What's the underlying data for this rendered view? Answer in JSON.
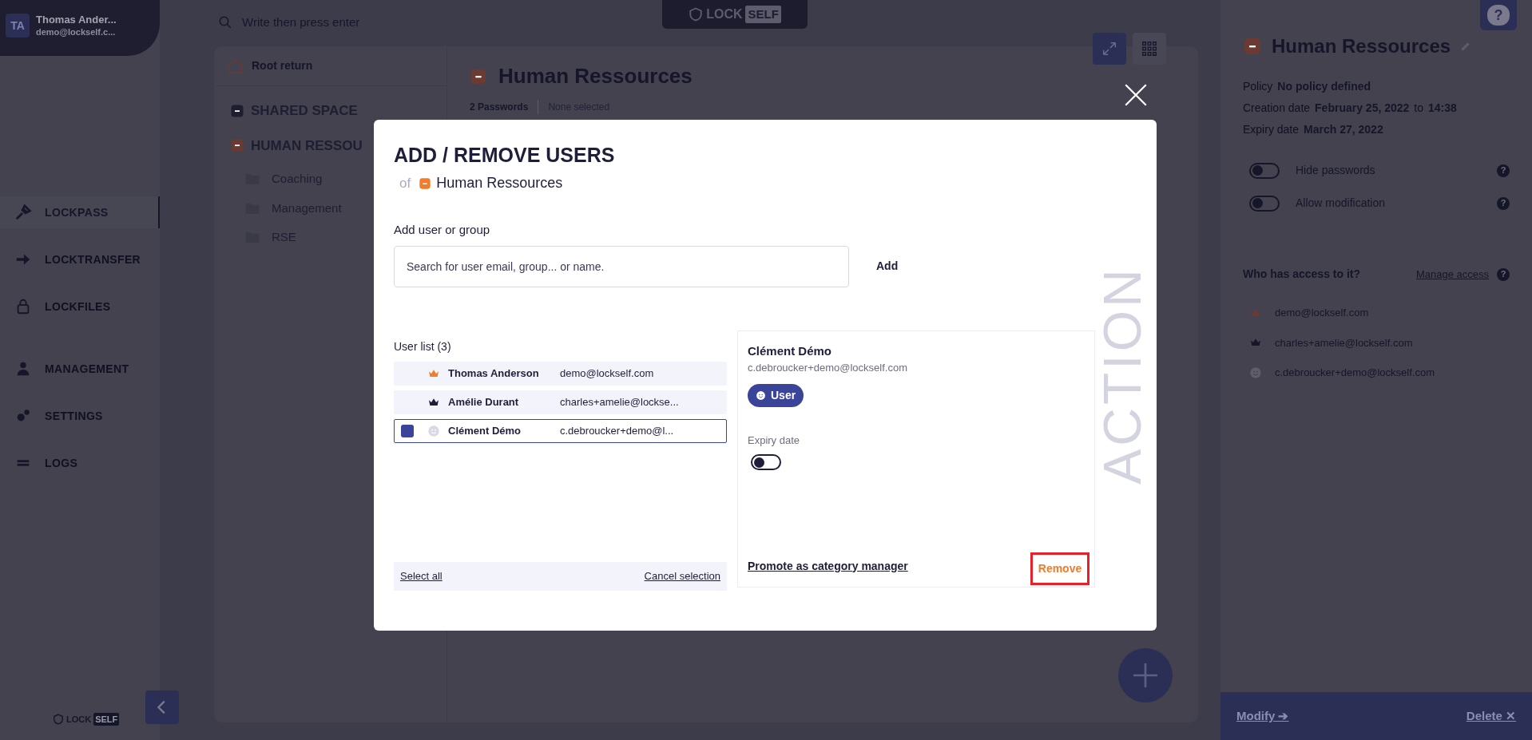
{
  "help_button": "?",
  "sidebar": {
    "user": {
      "initials": "TA",
      "name": "Thomas Ander...",
      "email": "demo@lockself.c..."
    },
    "items": [
      {
        "label": "LOCKPASS",
        "selected": true
      },
      {
        "label": "LOCKTRANSFER",
        "selected": false
      },
      {
        "label": "LOCKFILES",
        "selected": false
      },
      {
        "label": "MANAGEMENT",
        "selected": false
      },
      {
        "label": "SETTINGS",
        "selected": false
      },
      {
        "label": "LOGS",
        "selected": false
      }
    ],
    "logo": {
      "part_1": "LOCK",
      "part_2": "SELF"
    }
  },
  "topbar": {
    "search_placeholder": "Write then press enter",
    "logo": {
      "part_1": "LOCK",
      "part_2": "SELF"
    }
  },
  "tree": {
    "root": "Root return",
    "items": [
      {
        "label": "SHARED SPACE",
        "color": "#1e1e30"
      },
      {
        "label": "HUMAN RESSOU",
        "color": "#6a3a33",
        "children": [
          {
            "label": "Coaching"
          },
          {
            "label": "Management"
          },
          {
            "label": "RSE"
          }
        ]
      }
    ]
  },
  "category": {
    "title": "Human Ressources",
    "count": "2 Passwords",
    "selection": "None selected"
  },
  "modal": {
    "title": "ADD / REMOVE USERS",
    "of": "of",
    "category": "Human Ressources",
    "field_label": "Add user or group",
    "placeholder": "Search for user email, group... or name.",
    "add": "Add",
    "list_title": "User list (3)",
    "users": [
      {
        "name": "Thomas Anderson",
        "email": "demo@lockself.com",
        "kind": "owner",
        "selected": false
      },
      {
        "name": "Amélie Durant",
        "email": "charles+amelie@lockse...",
        "kind": "manager",
        "selected": false
      },
      {
        "name": "Clément Démo",
        "email": "c.debroucker+demo@l...",
        "kind": "user",
        "selected": true
      }
    ],
    "select_all": "Select all",
    "cancel_selection": "Cancel selection",
    "detail": {
      "name": "Clément Démo",
      "email": "c.debroucker+demo@lockself.com",
      "role": "User",
      "expiry_label": "Expiry date",
      "expiry_on": false,
      "promote": "Promote as category manager",
      "remove": "Remove"
    },
    "watermark": "ACTION"
  },
  "details": {
    "title": "Human Ressources",
    "policy_label": "Policy",
    "policy": "No policy defined",
    "creation_label": "Creation date",
    "creation_date": "February 25, 2022",
    "to": "to",
    "creation_time": "14:38",
    "expiry_label": "Expiry date",
    "expiry": "March 27, 2022",
    "toggles": [
      {
        "label": "Hide passwords",
        "on": false,
        "help": "?"
      },
      {
        "label": "Allow modification",
        "on": false,
        "help": "?"
      }
    ],
    "access_title": "Who has access to it?",
    "manage": "Manage access",
    "access_help": "?",
    "access": [
      {
        "email": "demo@lockself.com",
        "kind": "owner"
      },
      {
        "email": "charles+amelie@lockself.com",
        "kind": "manager"
      },
      {
        "email": "c.debroucker+demo@lockself.com",
        "kind": "user"
      }
    ],
    "modify": "Modify ➔",
    "delete": "Delete ✕"
  }
}
